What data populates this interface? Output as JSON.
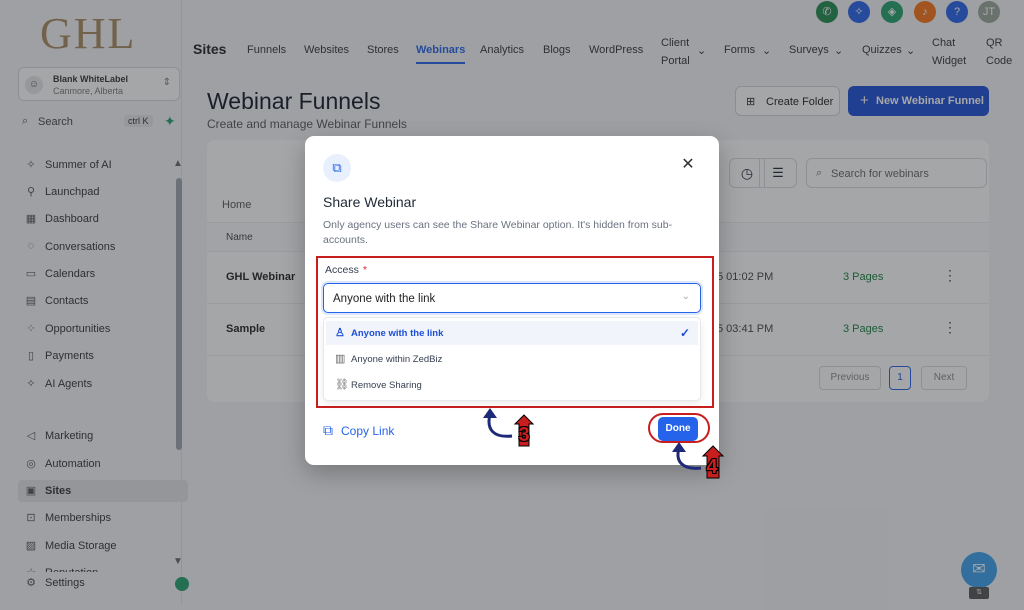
{
  "app": {
    "logo_text": "GHL",
    "account": {
      "name": "Blank WhiteLabel",
      "location": "Canmore, Alberta"
    },
    "search": {
      "label": "Search",
      "shortcut": "ctrl K"
    }
  },
  "sidebar": {
    "items": [
      {
        "label": "Summer of AI",
        "icon": "sparkle-icon",
        "glyph": "✧"
      },
      {
        "label": "Launchpad",
        "icon": "rocket-icon",
        "glyph": "⚲"
      },
      {
        "label": "Dashboard",
        "icon": "grid-icon",
        "glyph": "▦"
      },
      {
        "label": "Conversations",
        "icon": "chat-icon",
        "glyph": "◌"
      },
      {
        "label": "Calendars",
        "icon": "calendar-icon",
        "glyph": "▭"
      },
      {
        "label": "Contacts",
        "icon": "contacts-icon",
        "glyph": "▤"
      },
      {
        "label": "Opportunities",
        "icon": "opportunities-icon",
        "glyph": "⁘"
      },
      {
        "label": "Payments",
        "icon": "payments-icon",
        "glyph": "▯"
      },
      {
        "label": "AI Agents",
        "icon": "ai-icon",
        "glyph": "✧"
      },
      {
        "label": "Marketing",
        "icon": "send-icon",
        "glyph": "◁"
      },
      {
        "label": "Automation",
        "icon": "automation-icon",
        "glyph": "◎"
      },
      {
        "label": "Sites",
        "icon": "sites-icon",
        "glyph": "▣"
      },
      {
        "label": "Memberships",
        "icon": "memberships-icon",
        "glyph": "⊡"
      },
      {
        "label": "Media Storage",
        "icon": "media-icon",
        "glyph": "▨"
      },
      {
        "label": "Reputation",
        "icon": "reputation-icon",
        "glyph": "☆"
      },
      {
        "label": "Settings",
        "icon": "gear-icon",
        "glyph": "⚙"
      }
    ]
  },
  "topnav": {
    "brand": "Sites",
    "tabs": [
      {
        "label": "Funnels"
      },
      {
        "label": "Websites"
      },
      {
        "label": "Stores"
      },
      {
        "label": "Webinars"
      },
      {
        "label": "Analytics"
      },
      {
        "label": "Blogs"
      },
      {
        "label": "WordPress"
      },
      {
        "label": "Client Portal"
      },
      {
        "label": "Forms"
      },
      {
        "label": "Surveys"
      },
      {
        "label": "Quizzes"
      },
      {
        "label": "Chat Widget"
      },
      {
        "label": "QR Code"
      }
    ],
    "user_initials": "JT"
  },
  "page": {
    "title": "Webinar Funnels",
    "subtitle": "Create and manage Webinar Funnels",
    "create_folder": "Create Folder",
    "new_funnel": "New Webinar Funnel",
    "search_placeholder": "Search for webinars",
    "breadcrumb": "Home",
    "column_name": "Name",
    "rows": [
      {
        "name": "GHL Webinar",
        "date": "5 01:02 PM",
        "pages": "3 Pages"
      },
      {
        "name": "Sample",
        "date": "5 03:41 PM",
        "pages": "3 Pages"
      }
    ],
    "pagination": {
      "prev": "Previous",
      "current": "1",
      "next": "Next"
    }
  },
  "modal": {
    "title": "Share Webinar",
    "description": "Only agency users can see the Share Webinar option. It's hidden from sub-accounts.",
    "access_label": "Access",
    "required_mark": "*",
    "selected": "Anyone with the link",
    "options": [
      {
        "label": "Anyone with the link",
        "icon": "user-icon",
        "glyph": "♙"
      },
      {
        "label": "Anyone within ZedBiz",
        "icon": "building-icon",
        "glyph": "▥"
      },
      {
        "label": "Remove Sharing",
        "icon": "unlink-icon",
        "glyph": "⛓"
      }
    ],
    "copy_link": "Copy Link",
    "done": "Done"
  },
  "annotations": {
    "step_a": "3",
    "step_b": "4"
  },
  "colors": {
    "accent": "#2563eb",
    "annotation_red": "#c81e1e",
    "arrow_navy": "#1e2a78"
  }
}
